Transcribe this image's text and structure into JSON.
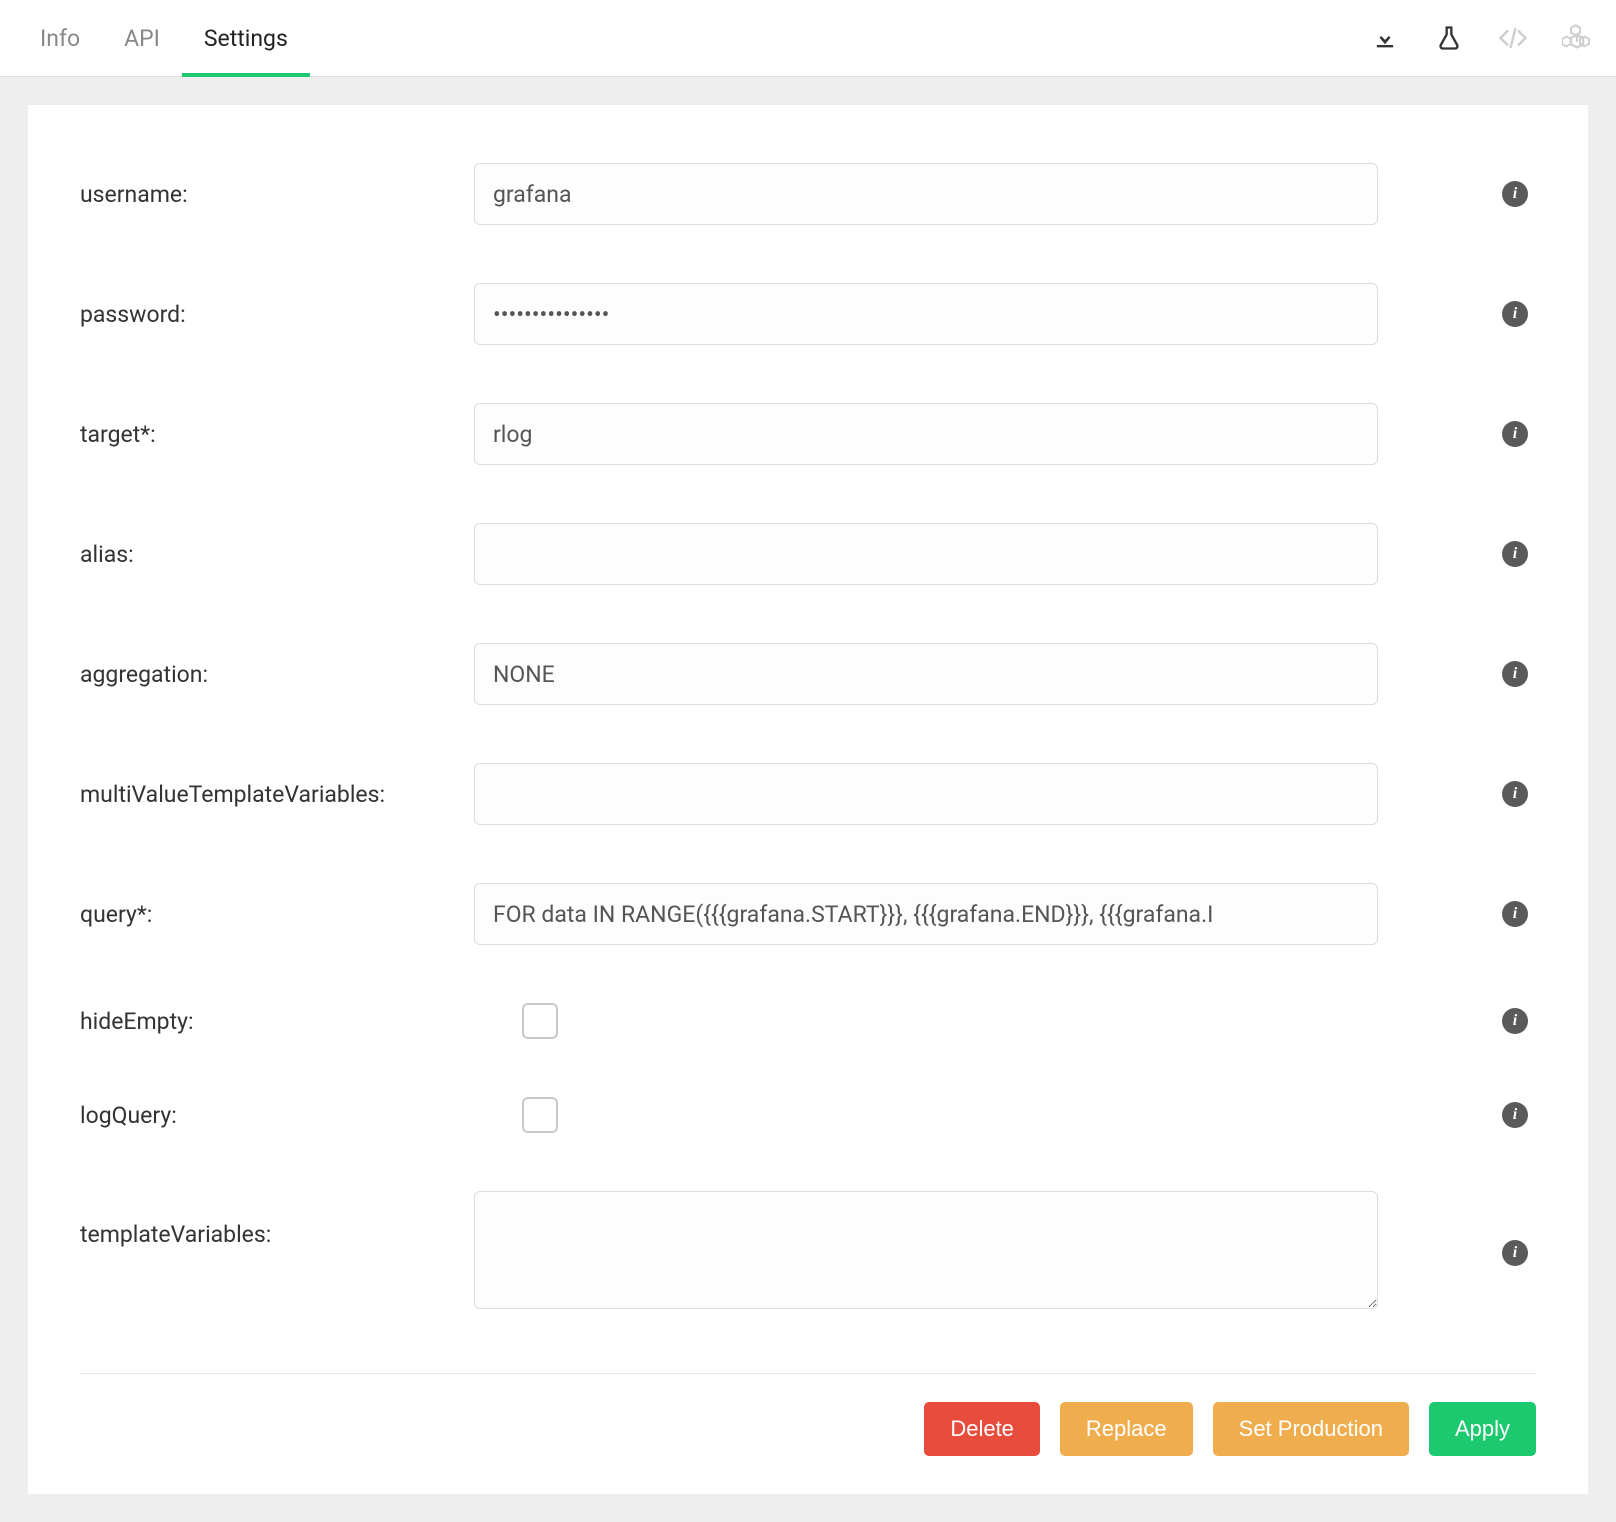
{
  "tabs": {
    "info": "Info",
    "api": "API",
    "settings": "Settings",
    "active": "settings"
  },
  "fields": {
    "username": {
      "label": "username:",
      "value": "grafana"
    },
    "password": {
      "label": "password:",
      "value": "•••••••••••••••"
    },
    "target": {
      "label": "target*:",
      "value": "rlog"
    },
    "alias": {
      "label": "alias:",
      "value": ""
    },
    "aggregation": {
      "label": "aggregation:",
      "value": "NONE"
    },
    "multi": {
      "label": "multiValueTemplateVariables:",
      "value": ""
    },
    "query": {
      "label": "query*:",
      "value": "FOR data IN RANGE({{{grafana.START}}}, {{{grafana.END}}}, {{{grafana.I"
    },
    "hideEmpty": {
      "label": "hideEmpty:"
    },
    "logQuery": {
      "label": "logQuery:"
    },
    "templateVariables": {
      "label": "templateVariables:",
      "value": ""
    }
  },
  "buttons": {
    "delete": "Delete",
    "replace": "Replace",
    "setprod": "Set Production",
    "apply": "Apply"
  },
  "info_glyph": "i"
}
